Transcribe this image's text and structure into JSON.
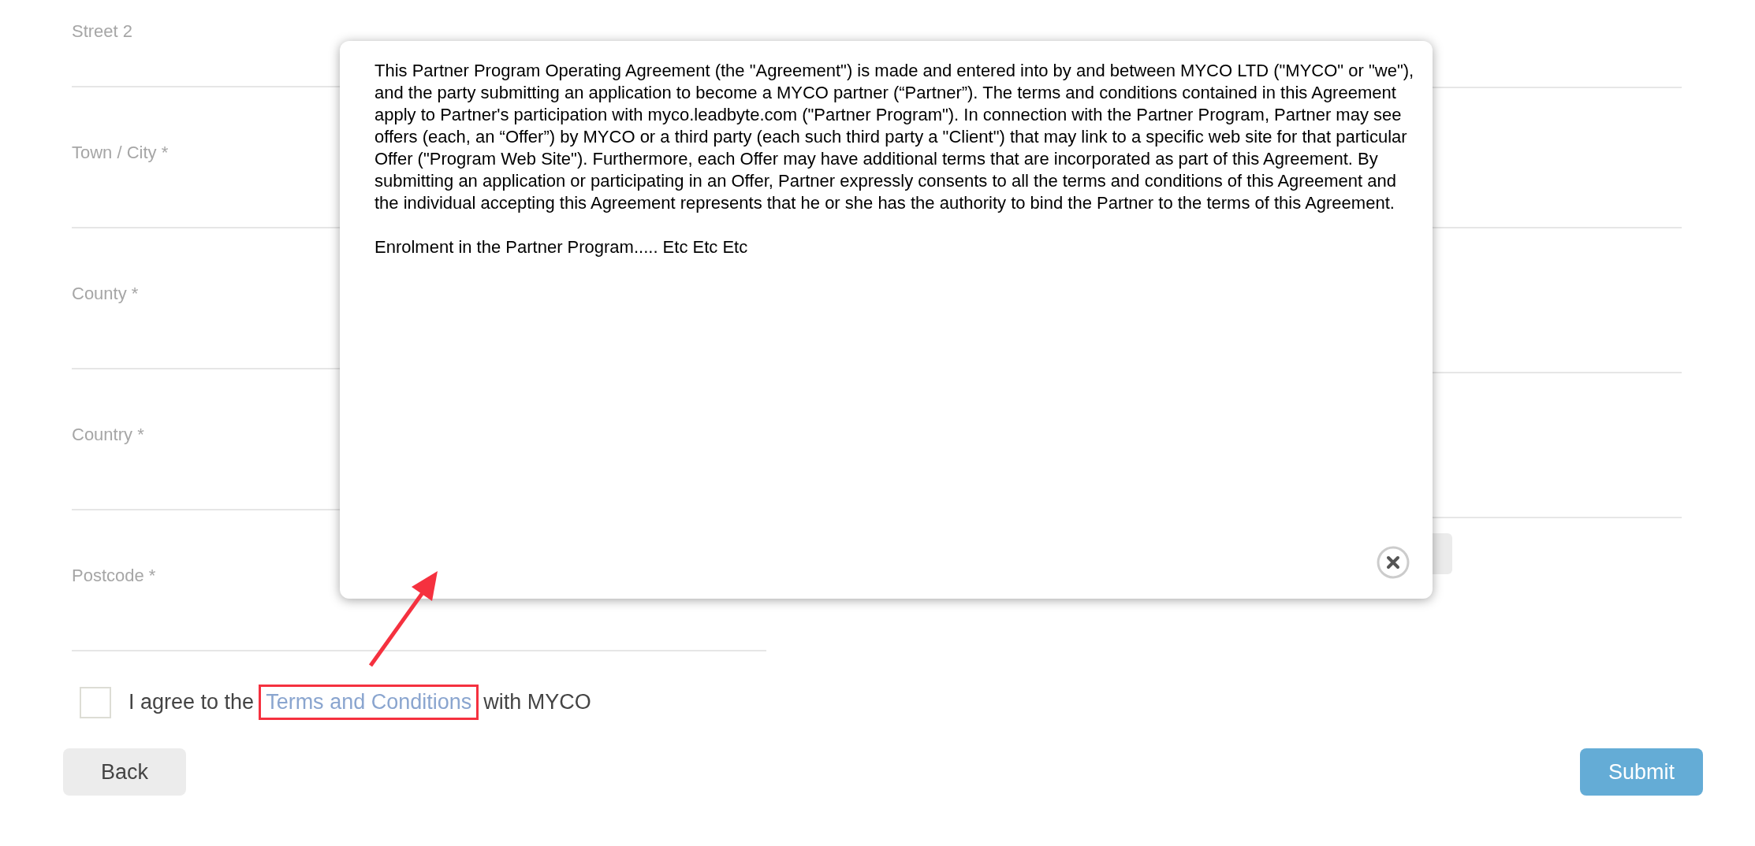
{
  "form": {
    "fields": [
      {
        "label": "Street 2"
      },
      {
        "label": "Town / City *"
      },
      {
        "label": "County *"
      },
      {
        "label": "Country *"
      },
      {
        "label": "Postcode *"
      }
    ]
  },
  "agreement": {
    "checked": false,
    "prefix": "I agree to the",
    "link": "Terms and Conditions",
    "suffix": "with MYCO"
  },
  "buttons": {
    "back": "Back",
    "submit": "Submit"
  },
  "modal": {
    "paragraphs": [
      "This Partner Program Operating Agreement (the \"Agreement\") is made and entered into by and between MYCO LTD (\"MYCO\" or \"we\"), and the party submitting an application to become a MYCO partner (“Partner”). The terms and conditions contained in this Agreement apply to Partner's participation with myco.leadbyte.com (\"Partner Program\"). In connection with the Partner Program, Partner may see offers (each, an “Offer”) by MYCO or a third party (each such third party a \"Client\") that may link to a specific web site for that particular Offer (\"Program Web Site\"). Furthermore, each Offer may have additional terms that are incorporated as part of this Agreement. By submitting an application or participating in an Offer, Partner expressly consents to all the terms and conditions of this Agreement and the individual accepting this Agreement represents that he or she has the authority to bind the Partner to the terms of this Agreement.",
      "Enrolment in the Partner Program..... Etc Etc Etc"
    ]
  }
}
